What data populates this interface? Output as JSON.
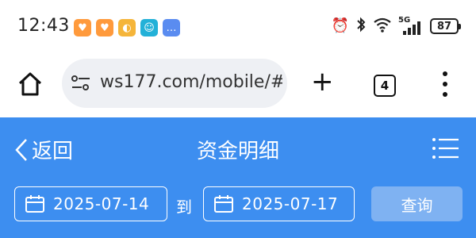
{
  "status_bar": {
    "time": "12:43",
    "notification_icons": [
      {
        "icon": "heart-app-icon",
        "color": "#ff9a3c",
        "glyph": "♥"
      },
      {
        "icon": "heart-app-icon",
        "color": "#ff9a3c",
        "glyph": "♥"
      },
      {
        "icon": "weather-app-icon",
        "color": "#f5b53a",
        "glyph": "◐"
      },
      {
        "icon": "chat-app-icon",
        "color": "#23b1d8",
        "glyph": "☺"
      },
      {
        "icon": "message-app-icon",
        "color": "#5a8cf0",
        "glyph": "…"
      }
    ],
    "network_label": "5G",
    "battery": "87"
  },
  "browser": {
    "url": "ws177.com/mobile/#",
    "tab_count": "4"
  },
  "header": {
    "back_label": "返回",
    "title": "资金明细"
  },
  "filter": {
    "start_date": "2025-07-14",
    "to_label": "到",
    "end_date": "2025-07-17",
    "query_label": "查询"
  },
  "colors": {
    "header_blue": "#3d8ef0",
    "query_button": "#7fb2f2"
  }
}
